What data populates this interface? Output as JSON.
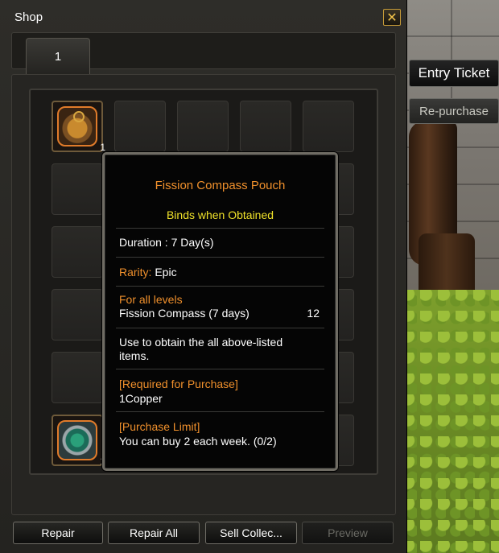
{
  "window": {
    "title": "Shop",
    "close_icon": "close-x-icon"
  },
  "tabs": [
    {
      "label": "1"
    }
  ],
  "side_buttons": {
    "entry_ticket": "Entry Ticket",
    "repurchase": "Re-purchase"
  },
  "grid": {
    "rows": 6,
    "cols": 5,
    "items": [
      {
        "row": 1,
        "col": 1,
        "icon": "pouch-icon",
        "qty": "1"
      },
      {
        "row": 6,
        "col": 1,
        "icon": "compass-icon",
        "qty": "1"
      }
    ]
  },
  "tooltip": {
    "name": "Fission Compass Pouch",
    "bind": "Binds when Obtained",
    "duration": "Duration : 7 Day(s)",
    "rarity_label": "Rarity:",
    "rarity_value": " Epic",
    "levels_label": "For all levels",
    "content_item": "Fission Compass (7 days)",
    "content_qty": "12",
    "description": "Use to obtain the all above-listed items.",
    "required_label": "[Required for Purchase]",
    "required_value": "1Copper",
    "limit_label": "[Purchase Limit]",
    "limit_value": "You can buy 2 each week. (0/2)"
  },
  "bottom_buttons": {
    "repair": "Repair",
    "repair_all": "Repair All",
    "sell_collectibles": "Sell Collec...",
    "preview": "Preview"
  },
  "colors": {
    "item_name": "#f0902c",
    "bind_text": "#f0e22a",
    "close_accent": "#f0c24a"
  }
}
